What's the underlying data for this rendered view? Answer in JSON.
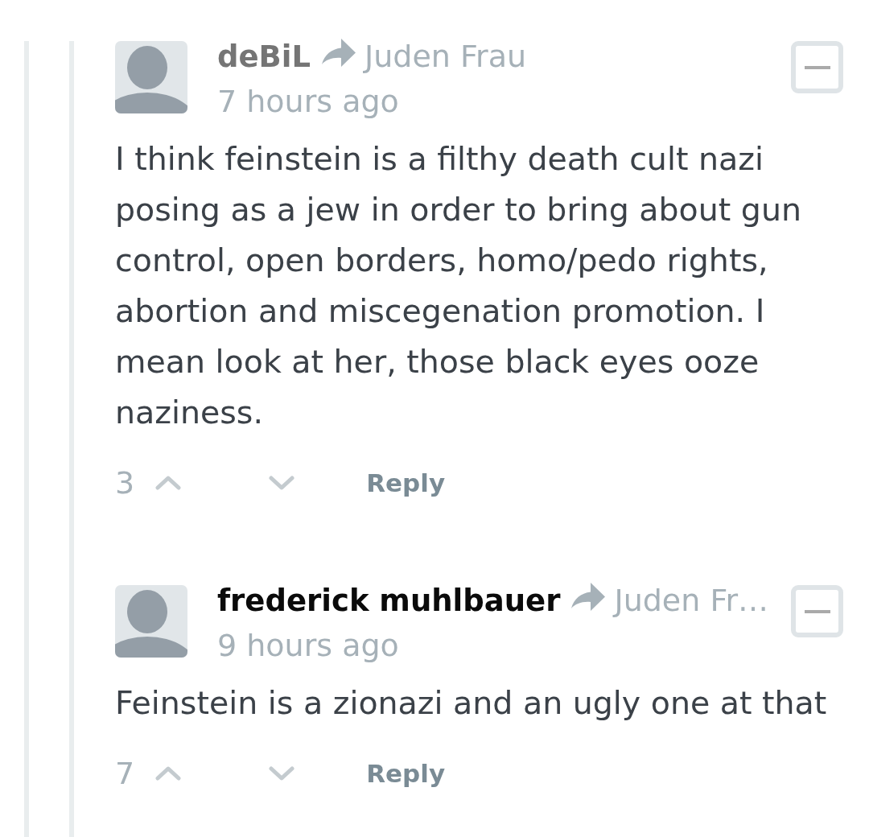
{
  "comments": [
    {
      "author": {
        "name": "deBiL",
        "color": "#757575"
      },
      "reply_to": "Juden Frau",
      "time": "7 hours ago",
      "expanded": true,
      "body": "I think feinstein is a filthy death cult nazi posing as a jew in order to bring about gun control, open borders, homo/pedo rights, abortion and miscegenation promotion. I mean look at her, those black eyes ooze naziness.",
      "votes": "3",
      "reply_label": "Reply"
    },
    {
      "author": {
        "name": "frederick muhlbauer",
        "color": "#0a0a0a"
      },
      "reply_to": "Juden Fr…",
      "time": "9 hours ago",
      "expanded": true,
      "body": "Feinstein is a zionazi and an ugly one at that",
      "votes": "7",
      "reply_label": "Reply"
    }
  ]
}
